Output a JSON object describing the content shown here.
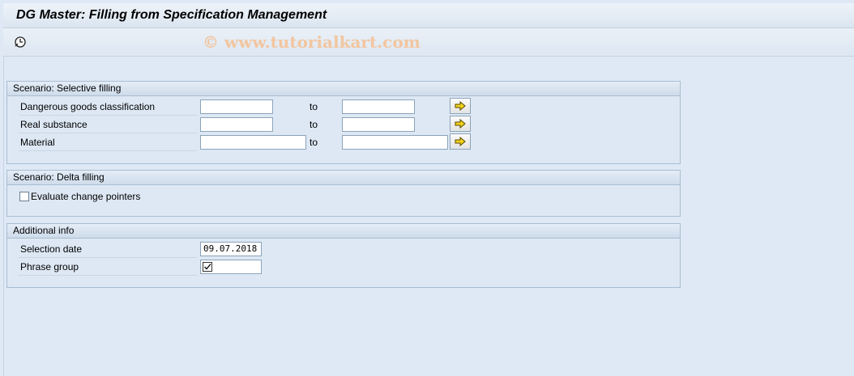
{
  "window": {
    "title": "DG Master: Filling from Specification Management"
  },
  "toolbar": {
    "execute_icon": "execute-clock-icon",
    "watermark": "© www.tutorialkart.com"
  },
  "selective": {
    "header": "Scenario: Selective filling",
    "rows": [
      {
        "label": "Dangerous goods classification",
        "from": "",
        "to_label": "to",
        "to": ""
      },
      {
        "label": "Real substance",
        "from": "",
        "to_label": "to",
        "to": ""
      },
      {
        "label": "Material",
        "from": "",
        "to_label": "to",
        "to": ""
      }
    ],
    "arrow_icon": "multiple-selection-arrow-icon"
  },
  "delta": {
    "header": "Scenario: Delta filling",
    "checkbox_label": "Evaluate change pointers",
    "checked": false
  },
  "additional": {
    "header": "Additional info",
    "selection_date_label": "Selection date",
    "selection_date": "09.07.2018",
    "phrase_group_label": "Phrase group",
    "phrase_group_checked": true
  },
  "colors": {
    "background": "#dfe9f5",
    "group_border": "#a8bdd1",
    "arrow_yellow": "#f3d21c"
  }
}
